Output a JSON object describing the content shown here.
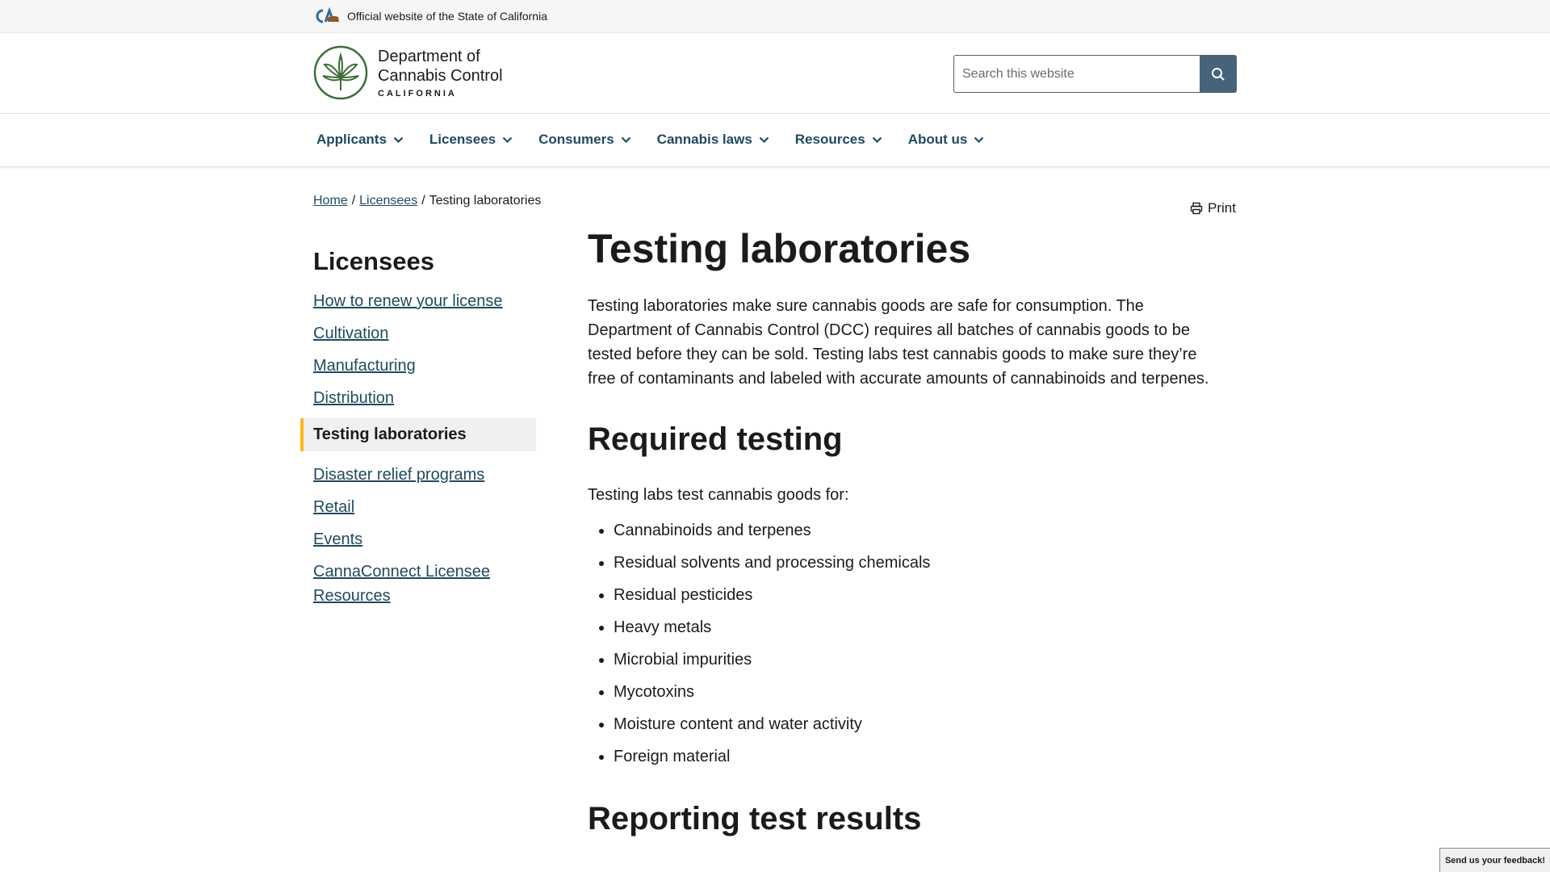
{
  "utility": {
    "logo_icon": "ca-state-logo-icon",
    "text": "Official website of the State of California"
  },
  "brand": {
    "line1": "Department of",
    "line2": "Cannabis Control",
    "line3": "CALIFORNIA",
    "seal_icon": "cannabis-leaf-seal-icon",
    "seal_color": "#3c6e3a"
  },
  "search": {
    "placeholder": "Search this website",
    "button_icon": "search-icon",
    "button_color": "#466379"
  },
  "nav": {
    "items": [
      {
        "label": "Applicants"
      },
      {
        "label": "Licensees"
      },
      {
        "label": "Consumers"
      },
      {
        "label": "Cannabis laws"
      },
      {
        "label": "Resources"
      },
      {
        "label": "About us"
      }
    ]
  },
  "breadcrumb": {
    "home": "Home",
    "licensees": "Licensees",
    "current": "Testing laboratories"
  },
  "print": {
    "label": "Print",
    "icon": "printer-icon"
  },
  "sidenav": {
    "title": "Licensees",
    "items_before": [
      "How to renew your license",
      "Cultivation",
      "Manufacturing",
      "Distribution"
    ],
    "active": "Testing laboratories",
    "items_after": [
      "Disaster relief programs",
      "Retail",
      "Events",
      "CannaConnect Licensee Resources"
    ],
    "active_accent": "#fdb81e"
  },
  "main": {
    "title": "Testing laboratories",
    "intro": "Testing laboratories make sure cannabis goods are safe for consumption. The Department of Cannabis Control (DCC) requires all batches of cannabis goods to be tested before they can be sold. Testing labs test cannabis goods to make sure they’re free of contaminants and labeled with accurate amounts of cannabinoids and terpenes.",
    "required_heading": "Required testing",
    "required_lead": "Testing labs test cannabis goods for:",
    "required_items": [
      "Cannabinoids and terpenes",
      "Residual solvents and processing chemicals",
      "Residual pesticides",
      "Heavy metals",
      "Microbial impurities",
      "Mycotoxins",
      "Moisture content and water activity",
      "Foreign material"
    ],
    "reporting_heading": "Reporting test results"
  },
  "feedback": {
    "label": "Send us your feedback!"
  },
  "colors": {
    "link": "#1f4a5f",
    "text": "#1b1b1b"
  }
}
